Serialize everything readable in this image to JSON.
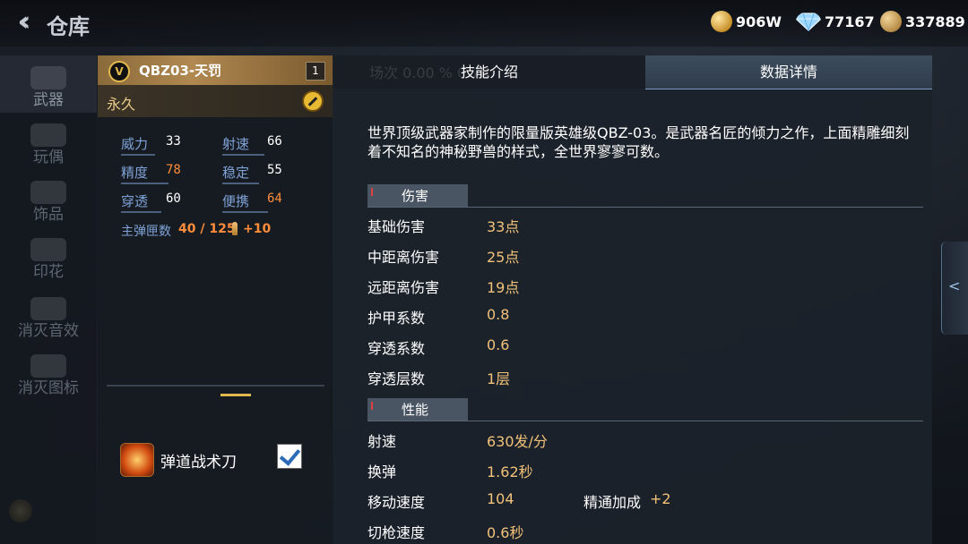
{
  "header": {
    "back_icon": "double-chevron-left-icon",
    "title": "仓库",
    "currencies": [
      {
        "icon": "gold-coin-icon",
        "value": "906W"
      },
      {
        "icon": "diamond-icon",
        "value": "77167"
      },
      {
        "icon": "medal-coin-icon",
        "value": "337889"
      }
    ]
  },
  "nav": {
    "items": [
      {
        "label": "武器",
        "active": true
      },
      {
        "label": "玩偶"
      },
      {
        "label": "饰品"
      },
      {
        "label": "印花"
      },
      {
        "label": "消灭音效"
      },
      {
        "label": "消灭图标"
      }
    ]
  },
  "weapon": {
    "rank": "V",
    "name": "QBZ03-天罚",
    "count": "1",
    "duration": "永久",
    "stats": [
      {
        "label": "威力",
        "value": "33",
        "orange": false,
        "bar": 0.5
      },
      {
        "label": "射速",
        "value": "66",
        "orange": false,
        "bar": 0.62
      },
      {
        "label": "精度",
        "value": "78",
        "orange": true,
        "bar": 0.7
      },
      {
        "label": "稳定",
        "value": "55",
        "orange": false,
        "bar": 0.55
      },
      {
        "label": "穿透",
        "value": "60",
        "orange": false,
        "bar": 0.6
      },
      {
        "label": "便携",
        "value": "64",
        "orange": true,
        "bar": 0.68
      }
    ],
    "magazine_label": "主弹匣数",
    "magazine_value": "40 / 125",
    "ammo_bonus": "+10",
    "melee": {
      "name": "弹道战术刀",
      "checked": true
    }
  },
  "info": {
    "tabs": {
      "skill": "技能介绍",
      "data": "数据详情",
      "active": "data"
    },
    "ghost_text": "场次          0.00 %      0.78",
    "description": "世界顶级武器家制作的限量版英雄级QBZ-03。是武器名匠的倾力之作，上面精雕细刻着不知名的神秘野兽的样式，全世界寥寥可数。",
    "sections": {
      "damage": {
        "title": "伤害",
        "rows": [
          {
            "label": "基础伤害",
            "value": "33点"
          },
          {
            "label": "中距离伤害",
            "value": "25点"
          },
          {
            "label": "远距离伤害",
            "value": "19点"
          },
          {
            "label": "护甲系数",
            "value": "0.8"
          },
          {
            "label": "穿透系数",
            "value": "0.6"
          },
          {
            "label": "穿透层数",
            "value": "1层"
          }
        ]
      },
      "performance": {
        "title": "性能",
        "rows": [
          {
            "label": "射速",
            "value": "630发/分"
          },
          {
            "label": "换弹",
            "value": "1.62秒"
          },
          {
            "label": "移动速度",
            "value": "104"
          },
          {
            "label": "切枪速度",
            "value": "0.6秒"
          }
        ],
        "mastery_label": "精通加成",
        "mastery_value": "+2"
      }
    },
    "expand_icon": "chevron-left-icon"
  }
}
